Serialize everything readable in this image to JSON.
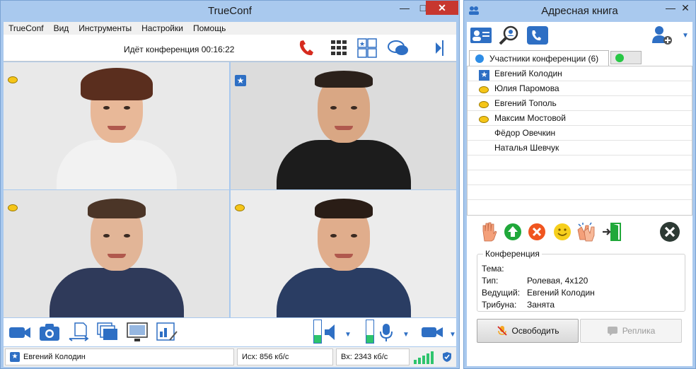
{
  "main_window": {
    "title": "TrueConf",
    "controls": {
      "minimize": "—",
      "maximize": "□",
      "close": "✕"
    },
    "menu": [
      "TrueConf",
      "Вид",
      "Инструменты",
      "Настройки",
      "Помощь"
    ],
    "conference_status": "Идёт конференция 00:16:22",
    "toolbar_icons": [
      "hangup-icon",
      "dialpad-icon",
      "layout-icon",
      "chat-icon",
      "panel-toggle-icon"
    ],
    "bottom_icons": [
      "camera-icon",
      "snapshot-icon",
      "file-transfer-icon",
      "slideshow-icon",
      "screen-share-icon",
      "whiteboard-icon"
    ],
    "speaker_level": 0.35,
    "mic_level": 0.35,
    "status": {
      "user": "Евгений Колодин",
      "outgoing": "Исх: 856 кб/с",
      "incoming": "Вх: 2343 кб/с",
      "signal_bars": 5
    }
  },
  "address_book": {
    "title": "Адресная книга",
    "controls": {
      "minimize": "—",
      "close": "✕"
    },
    "toolbar_icons": [
      "contacts-icon",
      "search-icon",
      "call-history-icon",
      "add-user-icon"
    ],
    "tab_label": "Участники конференции (6)",
    "participants": [
      {
        "name": "Евгений Колодин",
        "status": "star"
      },
      {
        "name": "Юлия Паромова",
        "status": "yellow"
      },
      {
        "name": "Евгений Тополь",
        "status": "yellow"
      },
      {
        "name": "Максим Мостовой",
        "status": "yellow"
      },
      {
        "name": "Фёдор Овечкин",
        "status": "none"
      },
      {
        "name": "Наталья Шевчук",
        "status": "none"
      }
    ],
    "actions": [
      "raise-hand-icon",
      "promote-icon",
      "remove-icon",
      "smile-icon",
      "applause-icon",
      "exit-icon",
      "close-conference-icon"
    ],
    "conference": {
      "legend": "Конференция",
      "topic_label": "Тема:",
      "topic_value": "",
      "type_label": "Тип:",
      "type_value": "Ролевая, 4x120",
      "host_label": "Ведущий:",
      "host_value": "Евгений Колодин",
      "tribune_label": "Трибуна:",
      "tribune_value": "Занята"
    },
    "buttons": {
      "release": "Освободить",
      "reply": "Реплика"
    }
  },
  "colors": {
    "accent": "#2e6fc4",
    "window_frame": "#a9c9ee",
    "hangup": "#d62b1f"
  }
}
